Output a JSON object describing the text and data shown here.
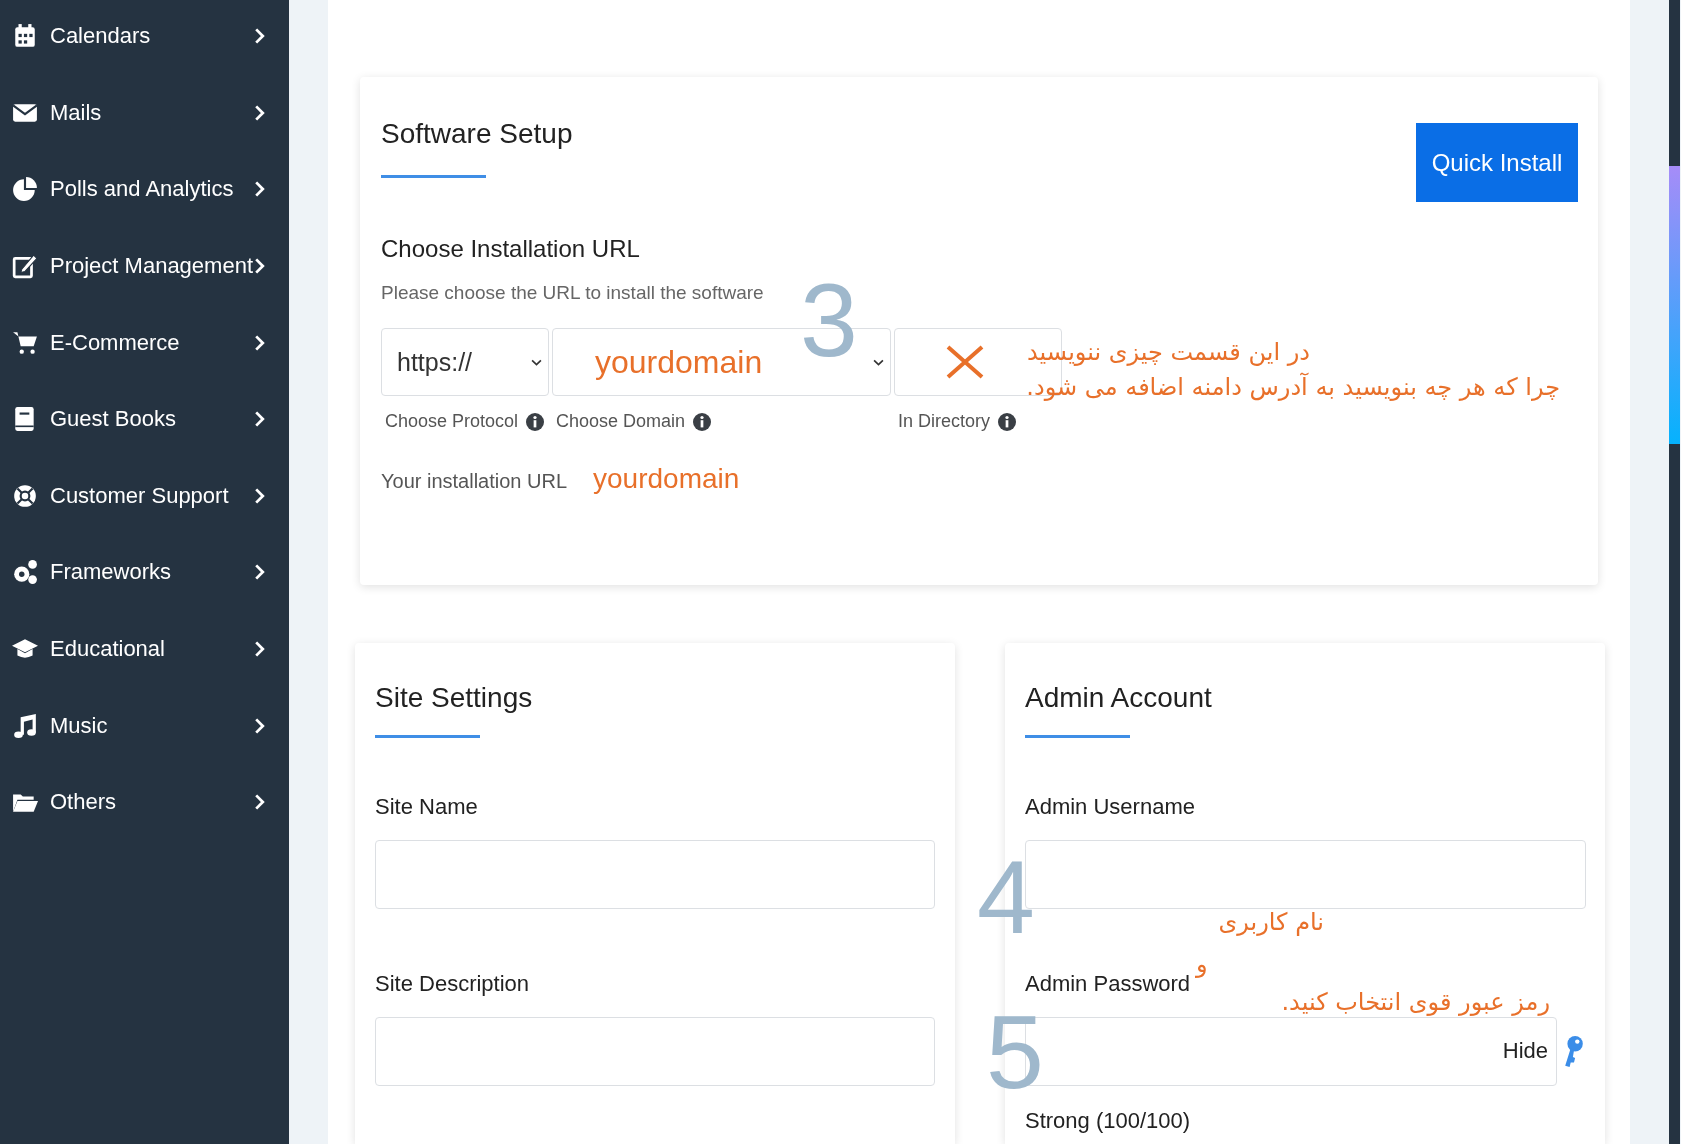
{
  "sidebar": {
    "items": [
      {
        "label": "Calendars"
      },
      {
        "label": "Mails"
      },
      {
        "label": "Polls and Analytics"
      },
      {
        "label": "Project Management"
      },
      {
        "label": "E-Commerce"
      },
      {
        "label": "Guest Books"
      },
      {
        "label": "Customer Support"
      },
      {
        "label": "Frameworks"
      },
      {
        "label": "Educational"
      },
      {
        "label": "Music"
      },
      {
        "label": "Others"
      }
    ]
  },
  "software_setup": {
    "title": "Software Setup",
    "button": "Quick Install",
    "url_heading": "Choose Installation URL",
    "url_hint": "Please choose the URL to install the software",
    "protocol": {
      "value": "https://",
      "label": "Choose Protocol"
    },
    "domain": {
      "value": "yourdomain",
      "label": "Choose Domain"
    },
    "directory": {
      "label": "In Directory"
    },
    "installation_url": {
      "label": "Your installation URL",
      "value": "yourdomain"
    }
  },
  "site_settings": {
    "title": "Site Settings",
    "fields": [
      {
        "label": "Site Name"
      },
      {
        "label": "Site Description"
      }
    ]
  },
  "admin_account": {
    "title": "Admin Account",
    "username_label": "Admin Username",
    "password_label": "Admin Password",
    "password_toggle": "Hide",
    "strength": "Strong (100/100)"
  },
  "annotations": [
    {
      "kind": "note",
      "text": "در این قسمت چیزی ننویسید"
    },
    {
      "kind": "note",
      "text": "چرا که هر چه  بنویسید به آدرس دامنه اضافه می شود."
    },
    {
      "kind": "number",
      "text": "3"
    },
    {
      "kind": "note",
      "text": "نام کاربری"
    },
    {
      "kind": "number",
      "text": "4"
    },
    {
      "kind": "note",
      "text": "و"
    },
    {
      "kind": "note",
      "text": "رمز عبور قوی انتخاب کنید."
    },
    {
      "kind": "number",
      "text": "5"
    }
  ]
}
